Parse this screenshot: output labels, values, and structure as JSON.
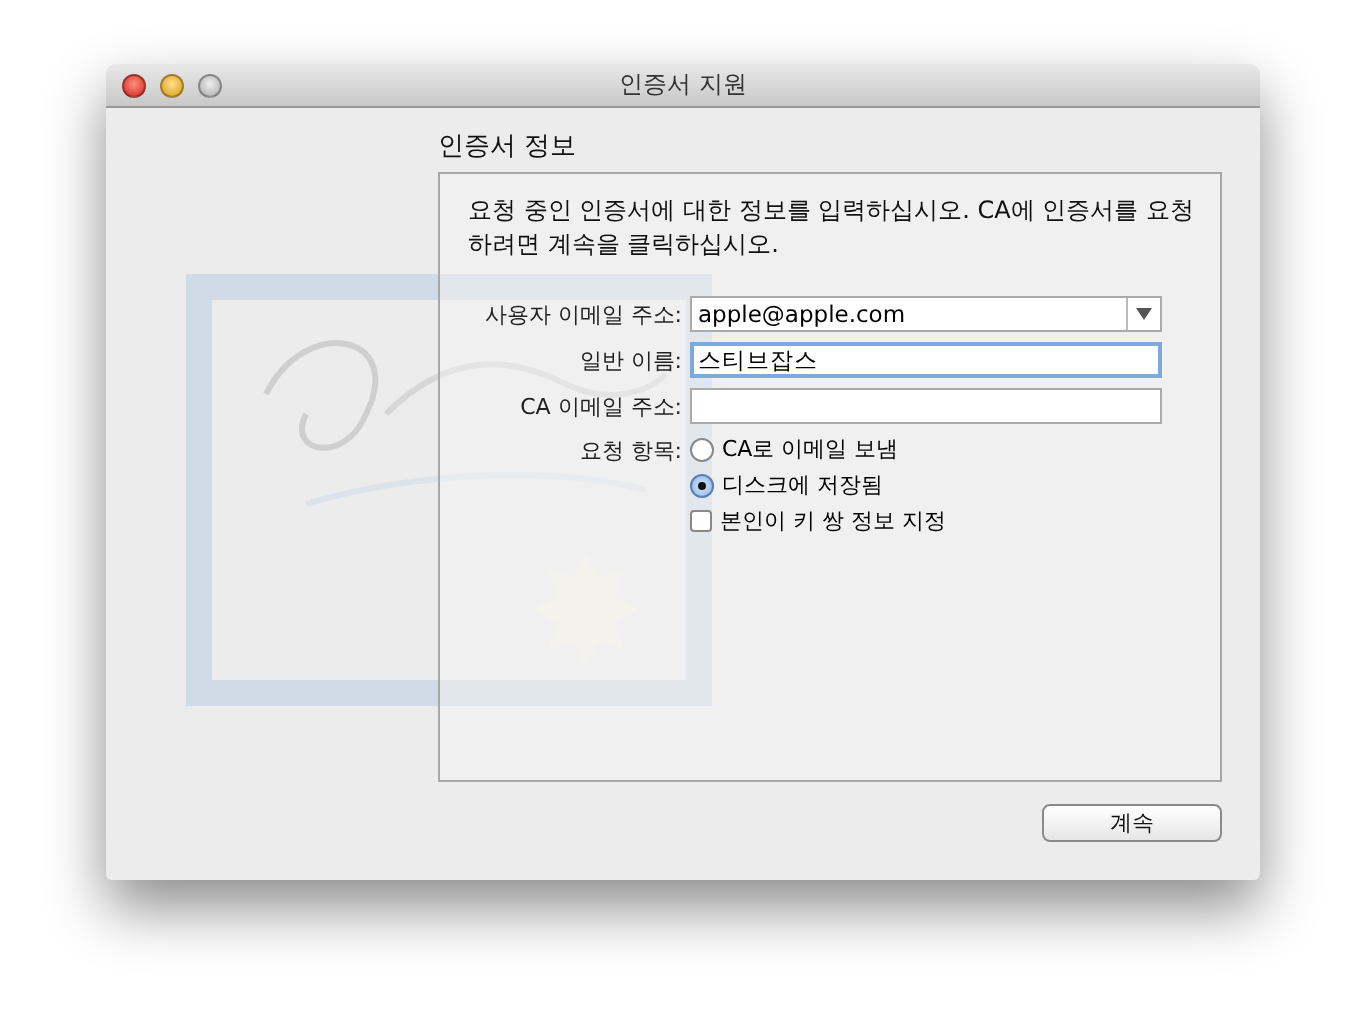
{
  "window": {
    "title": "인증서 지원"
  },
  "section_title": "인증서 정보",
  "description": "요청 중인 인증서에 대한 정보를 입력하십시오. CA에 인증서를 요청하려면 계속을 클릭하십시오.",
  "fields": [
    {
      "label": "사용자 이메일 주소:",
      "kind": "popup",
      "value": "apple@apple.com"
    },
    {
      "label": "일반 이름:",
      "kind": "text",
      "value": "스티브잡스",
      "focused": true
    },
    {
      "label": "CA 이메일 주소:",
      "kind": "text",
      "focused": false
    }
  ],
  "request": {
    "label": "요청 항목:",
    "options": [
      {
        "label": "CA로 이메일 보냄",
        "selected": false
      },
      {
        "label": "디스크에 저장됨",
        "selected": true
      }
    ],
    "checkbox": {
      "label": "본인이 키 쌍 정보 지정",
      "checked": false
    }
  },
  "buttons": [
    "계속"
  ]
}
